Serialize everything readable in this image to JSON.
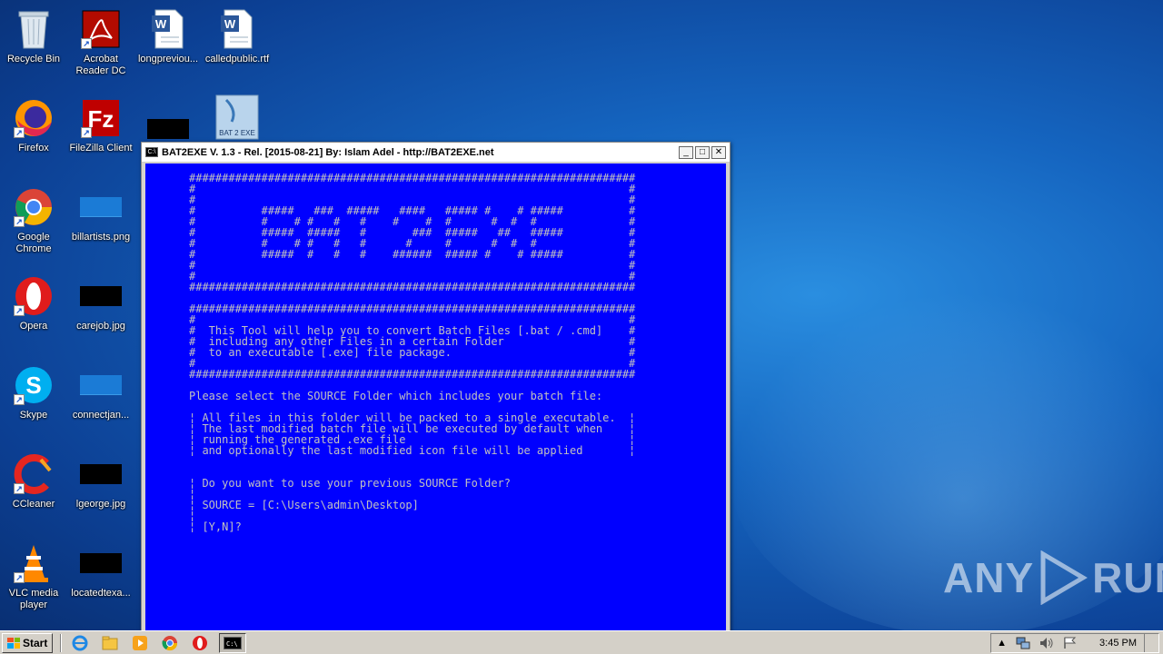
{
  "desktop": {
    "icons": [
      {
        "label": "Recycle Bin"
      },
      {
        "label": "Acrobat Reader DC"
      },
      {
        "label": "longpreviou..."
      },
      {
        "label": "calledpublic.rtf"
      },
      {
        "label": "Firefox"
      },
      {
        "label": "FileZilla Client"
      },
      {
        "label": "Google Chrome"
      },
      {
        "label": "billartists.png"
      },
      {
        "label": "Opera"
      },
      {
        "label": "carejob.jpg"
      },
      {
        "label": "Skype"
      },
      {
        "label": "connectjan..."
      },
      {
        "label": "CCleaner"
      },
      {
        "label": "lgeorge.jpg"
      },
      {
        "label": "VLC media player"
      },
      {
        "label": "locatedtexa..."
      }
    ],
    "bat2exe_icon_text": "BAT 2 EXE"
  },
  "console_window": {
    "title": "BAT2EXE V. 1.3 - Rel. [2015-08-21] By: Islam Adel - http://BAT2EXE.net",
    "buttons": {
      "minimize": "_",
      "maximize": "□",
      "close": "✕"
    },
    "lines": [
      "####################################################################",
      "#                                                                  #",
      "#                                                                  #",
      "#          #####   ###  #####   ####   ##### #    # #####          #",
      "#          #    # #   #   #    #    #  #      #  #  #              #",
      "#          #####  #####   #       ###  #####   ##   #####          #",
      "#          #    # #   #   #      #     #      #  #  #              #",
      "#          #####  #   #   #    ######  ##### #    # #####          #",
      "#                                                                  #",
      "#                                                                  #",
      "####################################################################",
      "",
      "####################################################################",
      "#                                                                  #",
      "#  This Tool will help you to convert Batch Files [.bat / .cmd]    #",
      "#  including any other Files in a certain Folder                   #",
      "#  to an executable [.exe] file package.                           #",
      "#                                                                  #",
      "####################################################################",
      "",
      "Please select the SOURCE Folder which includes your batch file:",
      "",
      "¦ All files in this folder will be packed to a single executable.  ¦",
      "¦ The last modified batch file will be executed by default when    ¦",
      "¦ running the generated .exe file                                  ¦",
      "¦ and optionally the last modified icon file will be applied       ¦",
      "",
      "",
      "¦ Do you want to use your previous SOURCE Folder?",
      "¦",
      "¦ SOURCE = [C:\\Users\\admin\\Desktop]",
      "¦",
      "¦ [Y,N]?"
    ]
  },
  "taskbar": {
    "start_label": "Start",
    "clock": "3:45 PM"
  },
  "watermark": {
    "text_left": "ANY",
    "text_right": "RUN"
  }
}
